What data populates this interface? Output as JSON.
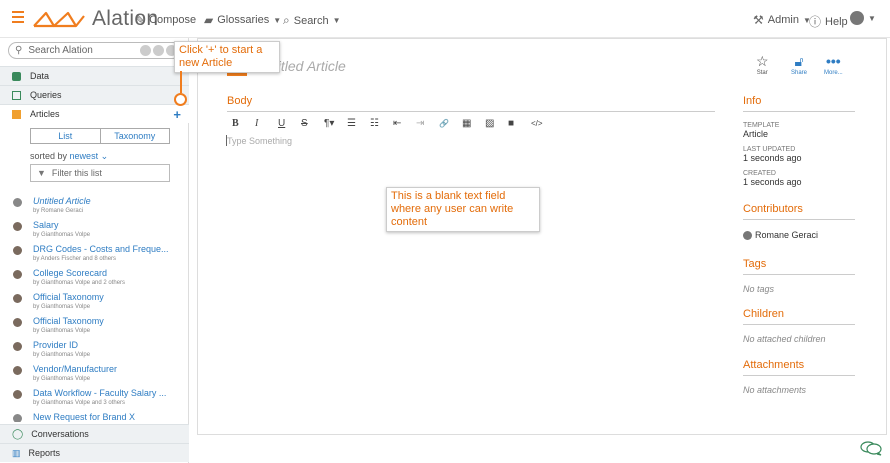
{
  "topbar": {
    "logo_text": "Alation",
    "compose_label": "Compose",
    "glossaries_label": "Glossaries",
    "search_label": "Search",
    "admin_label": "Admin",
    "help_label": "Help"
  },
  "sidebar": {
    "search_placeholder": "Search Alation",
    "sections": {
      "data": "Data",
      "queries": "Queries",
      "articles": "Articles"
    },
    "toggle": {
      "list": "List",
      "taxonomy": "Taxonomy"
    },
    "sorted_prefix": "sorted by",
    "sorted_value": "newest",
    "filter_placeholder": "Filter this list",
    "items": [
      {
        "title": "Untitled Article",
        "by": "by Romane Geraci"
      },
      {
        "title": "Salary",
        "by": "by Gianthomas Volpe"
      },
      {
        "title": "DRG Codes - Costs and Freque...",
        "by": "by Anders Fischer and 8 others"
      },
      {
        "title": "College Scorecard",
        "by": "by Gianthomas Volpe and 2 others"
      },
      {
        "title": "Official Taxonomy",
        "by": "by Gianthomas Volpe"
      },
      {
        "title": "Official Taxonomy",
        "by": "by Gianthomas Volpe"
      },
      {
        "title": "Provider ID",
        "by": "by Gianthomas Volpe"
      },
      {
        "title": "Vendor/Manufacturer",
        "by": "by Gianthomas Volpe"
      },
      {
        "title": "Data Workflow - Faculty Salary ...",
        "by": "by Gianthomas Volpe and 3 others"
      },
      {
        "title": "New Request for Brand X",
        "by": ""
      }
    ],
    "bottom": {
      "conversations": "Conversations",
      "reports": "Reports"
    }
  },
  "main": {
    "title": "Untitled Article",
    "body_label": "Body",
    "placeholder": "Type Something",
    "toolbar": [
      "B",
      "I",
      "U",
      "S",
      "¶▾",
      "☰",
      "☷",
      "⇤",
      "⇥",
      "🔗",
      "▦",
      "▨",
      "■",
      "</>"
    ],
    "actions": {
      "star": "Star",
      "share": "Share",
      "more": "More..."
    }
  },
  "right": {
    "info_heading": "Info",
    "template_label": "TEMPLATE",
    "template_value": "Article",
    "updated_label": "LAST UPDATED",
    "updated_value": "1 seconds ago",
    "created_label": "CREATED",
    "created_value": "1 seconds ago",
    "contributors_heading": "Contributors",
    "contributor": "Romane Geraci",
    "tags_heading": "Tags",
    "tags_value": "No tags",
    "children_heading": "Children",
    "children_value": "No attached children",
    "attachments_heading": "Attachments",
    "attachments_value": "No attachments"
  },
  "callouts": {
    "add_article": "Click '+' to start a new Article",
    "blank_field": "This is a blank text field where any user can write content"
  },
  "colors": {
    "accent": "#f07d1e",
    "heading": "#e36c0a",
    "link": "#2f7dc3"
  }
}
